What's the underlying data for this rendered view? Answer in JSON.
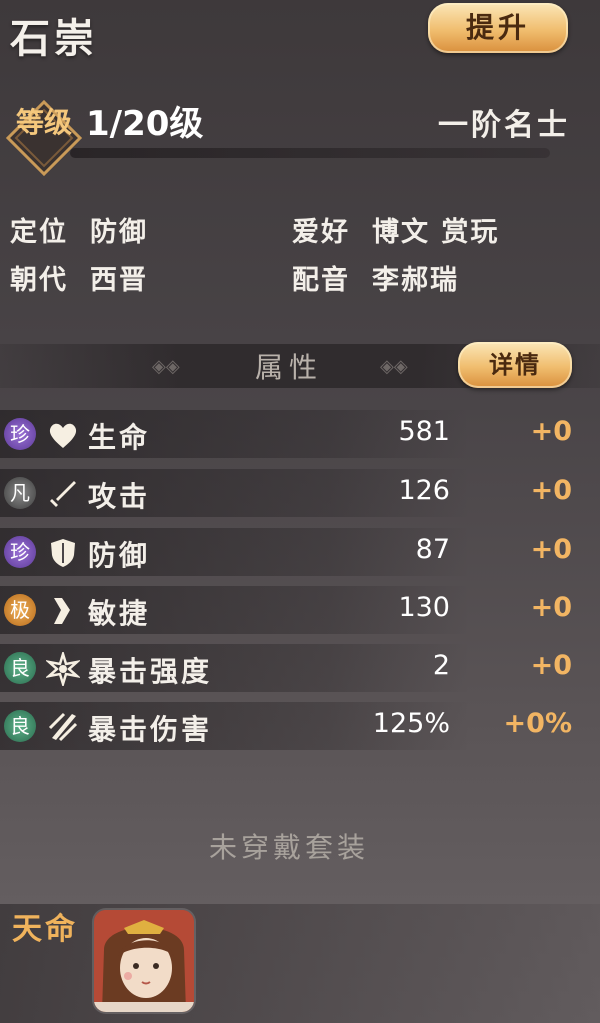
{
  "hero": {
    "name": "石崇",
    "promote_label": "提升"
  },
  "level": {
    "badge": "等级",
    "value": "1/20级",
    "rank": "一阶名士"
  },
  "info": {
    "position_label": "定位",
    "position": "防御",
    "hobby_label": "爱好",
    "hobby": "博文 赏玩",
    "dynasty_label": "朝代",
    "dynasty": "西晋",
    "voice_label": "配音",
    "voice": "李郝瑞"
  },
  "attributes": {
    "title": "属性",
    "detail_label": "详情",
    "rows": [
      {
        "grade": "珍",
        "name": "生命",
        "value": "581",
        "bonus": "+0",
        "icon": "heart-icon"
      },
      {
        "grade": "凡",
        "name": "攻击",
        "value": "126",
        "bonus": "+0",
        "icon": "sword-icon"
      },
      {
        "grade": "珍",
        "name": "防御",
        "value": "87",
        "bonus": "+0",
        "icon": "shield-icon"
      },
      {
        "grade": "极",
        "name": "敏捷",
        "value": "130",
        "bonus": "+0",
        "icon": "boot-icon"
      },
      {
        "grade": "良",
        "name": "暴击强度",
        "value": "2",
        "bonus": "+0",
        "icon": "star-burst-icon"
      },
      {
        "grade": "良",
        "name": "暴击伤害",
        "value": "125%",
        "bonus": "+0%",
        "icon": "slash-icon"
      }
    ]
  },
  "equipment": {
    "status": "未穿戴套装"
  },
  "fate": {
    "label": "天命"
  },
  "colors": {
    "gold": "#f2b563",
    "accent_button": "#f0bd6e"
  }
}
